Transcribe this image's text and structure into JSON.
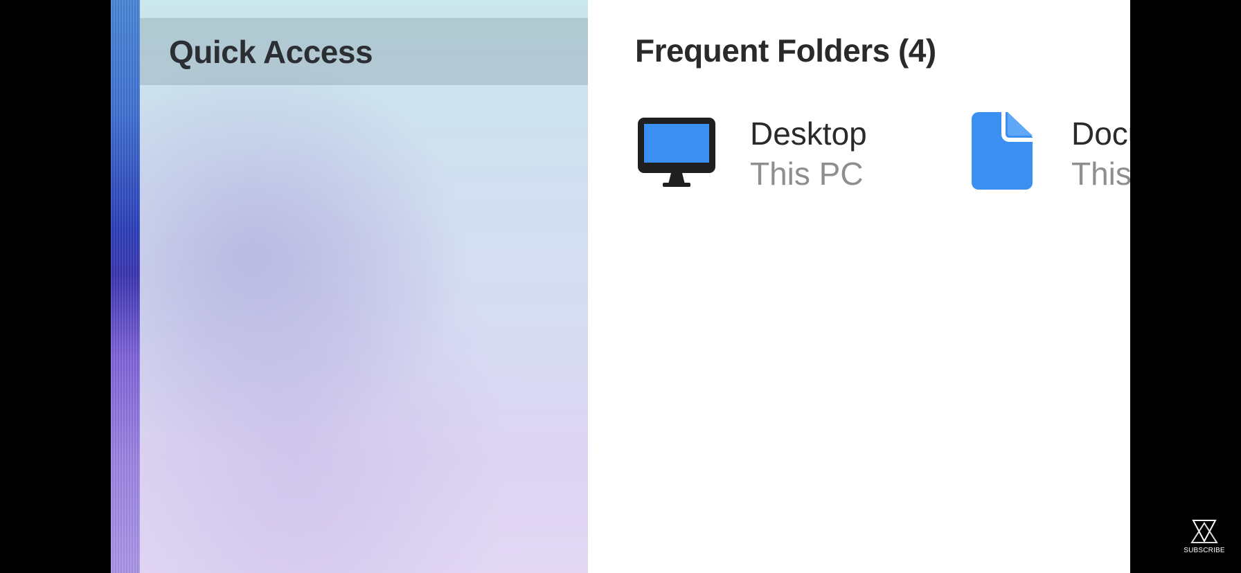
{
  "sidebar": {
    "items": [
      {
        "label": "Quick Access",
        "selected": true
      }
    ]
  },
  "main": {
    "section_title": "Frequent Folders (4)",
    "folders": [
      {
        "name": "Desktop",
        "location": "This PC",
        "icon": "desktop-monitor-icon"
      },
      {
        "name": "Documents",
        "location": "This PC",
        "icon": "document-icon"
      }
    ]
  },
  "watermark": {
    "label": "SUBSCRIBE"
  },
  "colors": {
    "accent_blue": "#3a8ff0",
    "sidebar_selection": "#a9bcc4",
    "secondary_text": "#8e8e8e"
  }
}
